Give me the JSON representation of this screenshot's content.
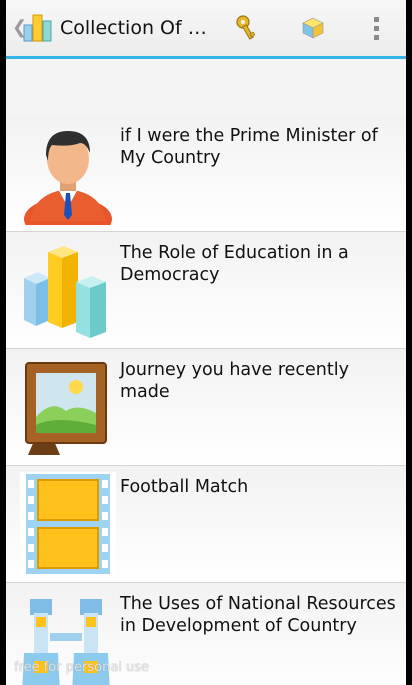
{
  "app": {
    "title": "Collection Of E..."
  },
  "actionbar_icons": [
    "key-icon",
    "cube-icon",
    "overflow-menu-icon"
  ],
  "accent_color": "#33b5e5",
  "items": [
    {
      "label": "if I were the Prime Minister of My Country",
      "icon": "businessman-icon"
    },
    {
      "label": "The Role of Education in a Democracy",
      "icon": "bar-chart-icon"
    },
    {
      "label": "Journey you have recently made",
      "icon": "picture-frame-icon"
    },
    {
      "label": "Football Match",
      "icon": "film-strip-icon"
    },
    {
      "label": "The Uses of National Resources in Development of Country",
      "icon": "binoculars-icon"
    }
  ],
  "watermark": "free for personal use"
}
